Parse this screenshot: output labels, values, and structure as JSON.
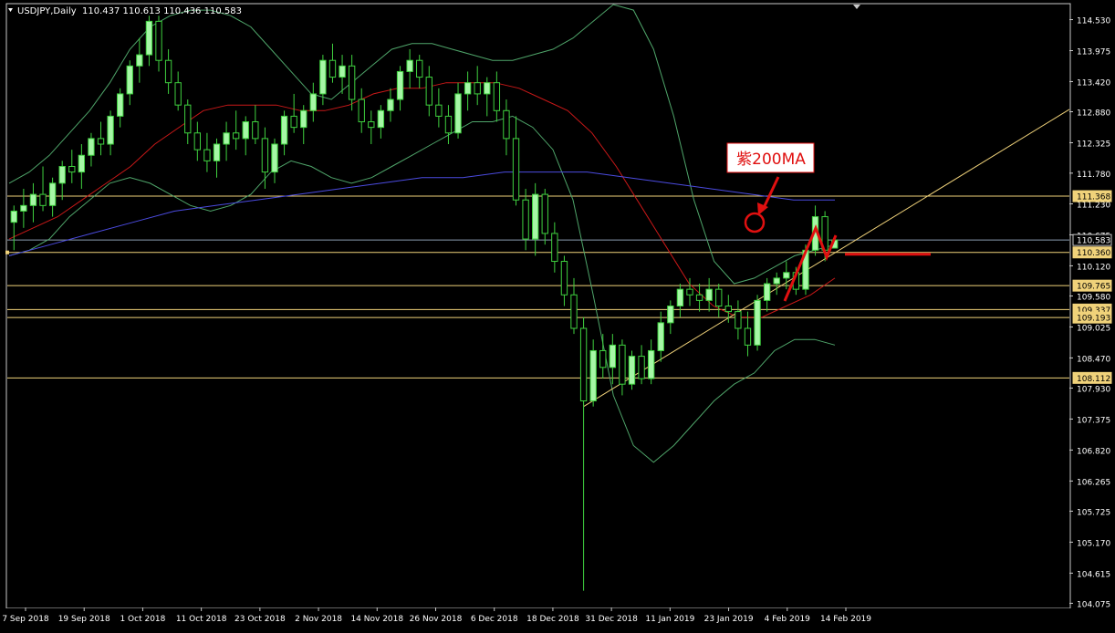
{
  "window": {
    "symbol_label": "USDJPY,Daily",
    "ohlc_label": "110.437 110.613 110.436 110.583"
  },
  "annotation": {
    "text": "紫200MA"
  },
  "colors": {
    "background": "#000000",
    "frame": "#c8c8c8",
    "bull_candle": "#a6f7a6",
    "bear_candle": "#000000",
    "wick": "#3fd13f",
    "bollinger": "#4fa56a",
    "ma_red": "#c81818",
    "ma_purple": "#4b4be0",
    "hline": "#f0d27a",
    "trendline": "#f0d27a",
    "price_line": "#8a9db0",
    "annotation_red": "#e01010",
    "axis_text": "#ffffff"
  },
  "chart_data": {
    "type": "candlestick",
    "ylim": [
      104.0,
      114.8
    ],
    "y_ticks": [
      "114.530",
      "113.975",
      "113.420",
      "112.880",
      "112.325",
      "111.780",
      "111.230",
      "110.675",
      "110.120",
      "109.580",
      "109.025",
      "108.470",
      "107.930",
      "107.375",
      "106.820",
      "106.265",
      "105.725",
      "105.170",
      "104.615",
      "104.075"
    ],
    "x_ticks": [
      "7 Sep 2018",
      "19 Sep 2018",
      "1 Oct 2018",
      "11 Oct 2018",
      "23 Oct 2018",
      "2 Nov 2018",
      "14 Nov 2018",
      "26 Nov 2018",
      "6 Dec 2018",
      "18 Dec 2018",
      "31 Dec 2018",
      "11 Jan 2019",
      "23 Jan 2019",
      "4 Feb 2019",
      "14 Feb 2019"
    ],
    "horizontal_levels": [
      {
        "value": 111.368,
        "label": "111.368",
        "style": "level"
      },
      {
        "value": 110.583,
        "label": "110.583",
        "style": "current"
      },
      {
        "value": 110.36,
        "label": "110.360",
        "style": "level"
      },
      {
        "value": 109.765,
        "label": "109.765",
        "style": "level"
      },
      {
        "value": 109.337,
        "label": "109.337",
        "style": "level"
      },
      {
        "value": 109.193,
        "label": "109.193",
        "style": "level"
      },
      {
        "value": 108.112,
        "label": "108.112",
        "style": "level"
      }
    ],
    "candles": [
      {
        "o": 110.9,
        "h": 111.2,
        "l": 110.4,
        "c": 111.1
      },
      {
        "o": 111.1,
        "h": 111.5,
        "l": 110.8,
        "c": 111.2
      },
      {
        "o": 111.2,
        "h": 111.6,
        "l": 110.9,
        "c": 111.4
      },
      {
        "o": 111.4,
        "h": 111.9,
        "l": 111.1,
        "c": 111.2
      },
      {
        "o": 111.2,
        "h": 111.7,
        "l": 111.0,
        "c": 111.6
      },
      {
        "o": 111.6,
        "h": 112.0,
        "l": 111.3,
        "c": 111.9
      },
      {
        "o": 111.9,
        "h": 112.2,
        "l": 111.6,
        "c": 111.8
      },
      {
        "o": 111.8,
        "h": 112.3,
        "l": 111.5,
        "c": 112.1
      },
      {
        "o": 112.1,
        "h": 112.5,
        "l": 111.9,
        "c": 112.4
      },
      {
        "o": 112.4,
        "h": 112.7,
        "l": 112.1,
        "c": 112.3
      },
      {
        "o": 112.3,
        "h": 112.9,
        "l": 112.1,
        "c": 112.8
      },
      {
        "o": 112.8,
        "h": 113.3,
        "l": 112.6,
        "c": 113.2
      },
      {
        "o": 113.2,
        "h": 113.8,
        "l": 113.0,
        "c": 113.7
      },
      {
        "o": 113.7,
        "h": 114.2,
        "l": 113.4,
        "c": 113.9
      },
      {
        "o": 113.9,
        "h": 114.6,
        "l": 113.7,
        "c": 114.5
      },
      {
        "o": 114.5,
        "h": 114.6,
        "l": 113.6,
        "c": 113.8
      },
      {
        "o": 113.8,
        "h": 114.0,
        "l": 113.2,
        "c": 113.4
      },
      {
        "o": 113.4,
        "h": 113.6,
        "l": 112.9,
        "c": 113.0
      },
      {
        "o": 113.0,
        "h": 113.1,
        "l": 112.3,
        "c": 112.5
      },
      {
        "o": 112.5,
        "h": 112.7,
        "l": 112.0,
        "c": 112.2
      },
      {
        "o": 112.2,
        "h": 112.5,
        "l": 111.8,
        "c": 112.0
      },
      {
        "o": 112.0,
        "h": 112.4,
        "l": 111.7,
        "c": 112.3
      },
      {
        "o": 112.3,
        "h": 112.7,
        "l": 112.0,
        "c": 112.5
      },
      {
        "o": 112.5,
        "h": 112.9,
        "l": 112.2,
        "c": 112.4
      },
      {
        "o": 112.4,
        "h": 112.8,
        "l": 112.1,
        "c": 112.7
      },
      {
        "o": 112.7,
        "h": 113.0,
        "l": 112.3,
        "c": 112.4
      },
      {
        "o": 112.4,
        "h": 112.6,
        "l": 111.5,
        "c": 111.8
      },
      {
        "o": 111.8,
        "h": 112.4,
        "l": 111.6,
        "c": 112.3
      },
      {
        "o": 112.3,
        "h": 112.9,
        "l": 112.1,
        "c": 112.8
      },
      {
        "o": 112.8,
        "h": 113.2,
        "l": 112.5,
        "c": 112.6
      },
      {
        "o": 112.6,
        "h": 113.0,
        "l": 112.3,
        "c": 112.9
      },
      {
        "o": 112.9,
        "h": 113.4,
        "l": 112.7,
        "c": 113.2
      },
      {
        "o": 113.2,
        "h": 113.9,
        "l": 113.0,
        "c": 113.8
      },
      {
        "o": 113.8,
        "h": 114.1,
        "l": 113.4,
        "c": 113.5
      },
      {
        "o": 113.5,
        "h": 113.9,
        "l": 113.2,
        "c": 113.7
      },
      {
        "o": 113.7,
        "h": 113.9,
        "l": 112.9,
        "c": 113.1
      },
      {
        "o": 113.1,
        "h": 113.3,
        "l": 112.5,
        "c": 112.7
      },
      {
        "o": 112.7,
        "h": 112.9,
        "l": 112.3,
        "c": 112.6
      },
      {
        "o": 112.6,
        "h": 113.0,
        "l": 112.4,
        "c": 112.9
      },
      {
        "o": 112.9,
        "h": 113.3,
        "l": 112.7,
        "c": 113.1
      },
      {
        "o": 113.1,
        "h": 113.7,
        "l": 112.9,
        "c": 113.6
      },
      {
        "o": 113.6,
        "h": 114.0,
        "l": 113.3,
        "c": 113.8
      },
      {
        "o": 113.8,
        "h": 113.9,
        "l": 113.3,
        "c": 113.5
      },
      {
        "o": 113.5,
        "h": 113.7,
        "l": 112.8,
        "c": 113.0
      },
      {
        "o": 113.0,
        "h": 113.3,
        "l": 112.6,
        "c": 112.8
      },
      {
        "o": 112.8,
        "h": 113.0,
        "l": 112.3,
        "c": 112.5
      },
      {
        "o": 112.5,
        "h": 113.4,
        "l": 112.4,
        "c": 113.2
      },
      {
        "o": 113.2,
        "h": 113.6,
        "l": 112.9,
        "c": 113.4
      },
      {
        "o": 113.4,
        "h": 113.7,
        "l": 113.0,
        "c": 113.2
      },
      {
        "o": 113.2,
        "h": 113.5,
        "l": 112.8,
        "c": 113.4
      },
      {
        "o": 113.4,
        "h": 113.6,
        "l": 112.7,
        "c": 112.9
      },
      {
        "o": 112.9,
        "h": 113.1,
        "l": 112.1,
        "c": 112.4
      },
      {
        "o": 112.4,
        "h": 112.8,
        "l": 111.2,
        "c": 111.3
      },
      {
        "o": 111.3,
        "h": 111.5,
        "l": 110.4,
        "c": 110.6
      },
      {
        "o": 110.6,
        "h": 111.6,
        "l": 110.3,
        "c": 111.4
      },
      {
        "o": 111.4,
        "h": 111.5,
        "l": 110.5,
        "c": 110.7
      },
      {
        "o": 110.7,
        "h": 110.9,
        "l": 110.0,
        "c": 110.2
      },
      {
        "o": 110.2,
        "h": 110.3,
        "l": 109.4,
        "c": 109.6
      },
      {
        "o": 109.6,
        "h": 109.9,
        "l": 108.9,
        "c": 109.0
      },
      {
        "o": 109.0,
        "h": 109.2,
        "l": 104.3,
        "c": 107.7
      },
      {
        "o": 107.7,
        "h": 108.8,
        "l": 107.6,
        "c": 108.6
      },
      {
        "o": 108.6,
        "h": 108.9,
        "l": 108.1,
        "c": 108.3
      },
      {
        "o": 108.3,
        "h": 108.9,
        "l": 108.0,
        "c": 108.7
      },
      {
        "o": 108.7,
        "h": 108.8,
        "l": 107.8,
        "c": 108.0
      },
      {
        "o": 108.0,
        "h": 108.6,
        "l": 107.9,
        "c": 108.5
      },
      {
        "o": 108.5,
        "h": 108.7,
        "l": 108.0,
        "c": 108.1
      },
      {
        "o": 108.1,
        "h": 108.8,
        "l": 108.0,
        "c": 108.6
      },
      {
        "o": 108.6,
        "h": 109.3,
        "l": 108.4,
        "c": 109.1
      },
      {
        "o": 109.1,
        "h": 109.5,
        "l": 108.9,
        "c": 109.4
      },
      {
        "o": 109.4,
        "h": 109.8,
        "l": 109.2,
        "c": 109.7
      },
      {
        "o": 109.7,
        "h": 109.9,
        "l": 109.4,
        "c": 109.6
      },
      {
        "o": 109.6,
        "h": 109.8,
        "l": 109.3,
        "c": 109.5
      },
      {
        "o": 109.5,
        "h": 109.9,
        "l": 109.3,
        "c": 109.7
      },
      {
        "o": 109.7,
        "h": 109.8,
        "l": 109.2,
        "c": 109.4
      },
      {
        "o": 109.4,
        "h": 109.6,
        "l": 109.1,
        "c": 109.3
      },
      {
        "o": 109.3,
        "h": 109.5,
        "l": 108.8,
        "c": 109.0
      },
      {
        "o": 109.0,
        "h": 109.3,
        "l": 108.5,
        "c": 108.7
      },
      {
        "o": 108.7,
        "h": 109.6,
        "l": 108.6,
        "c": 109.5
      },
      {
        "o": 109.5,
        "h": 109.9,
        "l": 109.3,
        "c": 109.8
      },
      {
        "o": 109.8,
        "h": 110.0,
        "l": 109.6,
        "c": 109.9
      },
      {
        "o": 109.9,
        "h": 110.2,
        "l": 109.7,
        "c": 110.0
      },
      {
        "o": 110.0,
        "h": 110.1,
        "l": 109.6,
        "c": 109.7
      },
      {
        "o": 109.7,
        "h": 110.5,
        "l": 109.6,
        "c": 110.4
      },
      {
        "o": 110.4,
        "h": 111.2,
        "l": 110.3,
        "c": 111.0
      },
      {
        "o": 111.0,
        "h": 111.1,
        "l": 110.2,
        "c": 110.4
      },
      {
        "o": 110.437,
        "h": 110.613,
        "l": 110.436,
        "c": 110.583
      }
    ],
    "bollinger_upper": [
      111.6,
      111.8,
      112.1,
      112.5,
      112.9,
      113.4,
      114.0,
      114.4,
      114.6,
      114.7,
      114.7,
      114.6,
      114.4,
      114.0,
      113.6,
      113.2,
      113.1,
      113.4,
      113.7,
      114.0,
      114.1,
      114.1,
      114.0,
      113.9,
      113.8,
      113.8,
      113.9,
      114.0,
      114.2,
      114.5,
      114.8,
      114.7,
      114.0,
      112.8,
      111.3,
      110.2,
      109.8,
      109.9,
      110.1,
      110.3,
      110.4,
      110.5
    ],
    "bollinger_lower": [
      110.3,
      110.4,
      110.6,
      111.0,
      111.3,
      111.6,
      111.7,
      111.6,
      111.4,
      111.2,
      111.1,
      111.2,
      111.4,
      111.8,
      112.0,
      111.9,
      111.7,
      111.6,
      111.7,
      111.9,
      112.1,
      112.3,
      112.5,
      112.7,
      112.7,
      112.8,
      112.6,
      112.2,
      111.3,
      109.6,
      107.8,
      106.9,
      106.6,
      106.9,
      107.3,
      107.7,
      108.0,
      108.2,
      108.6,
      108.8,
      108.8,
      108.7
    ],
    "ma_red": [
      110.6,
      110.8,
      111.0,
      111.3,
      111.6,
      111.9,
      112.3,
      112.6,
      112.9,
      113.0,
      113.0,
      113.0,
      112.9,
      112.9,
      113.0,
      113.2,
      113.3,
      113.3,
      113.4,
      113.4,
      113.4,
      113.3,
      113.1,
      112.9,
      112.5,
      111.9,
      111.2,
      110.5,
      109.8,
      109.4,
      109.2,
      109.2,
      109.4,
      109.6,
      109.9
    ],
    "ma_purple": [
      110.3,
      110.5,
      110.7,
      110.9,
      111.1,
      111.2,
      111.3,
      111.4,
      111.5,
      111.6,
      111.7,
      111.7,
      111.8,
      111.8,
      111.8,
      111.7,
      111.6,
      111.5,
      111.4,
      111.3,
      111.3
    ],
    "trendline": {
      "x0": 59,
      "y0": 107.6,
      "x1": 85,
      "y1": 110.35
    }
  }
}
